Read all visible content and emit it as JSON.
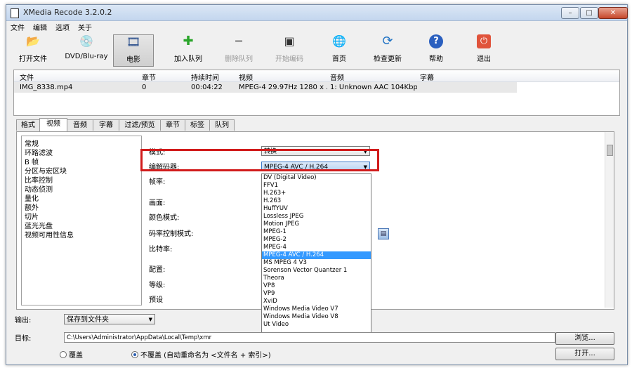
{
  "window": {
    "title": "XMedia Recode 3.2.0.2",
    "min_glyph": "–",
    "max_glyph": "□",
    "close_glyph": "✕"
  },
  "menu": [
    "文件",
    "编辑",
    "选项",
    "关于"
  ],
  "toolbar": [
    {
      "label": "打开文件",
      "icon": "open-folder-icon",
      "glyph": "📂"
    },
    {
      "label": "DVD/Blu-ray",
      "icon": "disc-icon",
      "glyph": "💿"
    },
    {
      "label": "电影",
      "icon": "film-icon",
      "glyph": "🎞",
      "active": true
    },
    {
      "label": "加入队列",
      "icon": "plus-icon",
      "glyph": "✚"
    },
    {
      "label": "删除队列",
      "icon": "minus-icon",
      "glyph": "━",
      "disabled": true
    },
    {
      "label": "开始编码",
      "icon": "encode-icon",
      "glyph": "▣",
      "disabled": true
    },
    {
      "label": "首页",
      "icon": "globe-icon",
      "glyph": "🌐"
    },
    {
      "label": "检查更新",
      "icon": "refresh-icon",
      "glyph": "⟳"
    },
    {
      "label": "帮助",
      "icon": "help-icon",
      "glyph": "?"
    },
    {
      "label": "退出",
      "icon": "power-icon",
      "glyph": "⏻"
    }
  ],
  "filelist": {
    "headers": [
      "文件",
      "章节",
      "持续时间",
      "视频",
      "音频",
      "字幕"
    ],
    "row": [
      "IMG_8338.mp4",
      "0",
      "00:04:22",
      "MPEG-4 29.97Hz 1280 x ...",
      "1: Unknown AAC 104Kbp...",
      ""
    ]
  },
  "tabs": [
    "格式",
    "视频",
    "音频",
    "字幕",
    "过滤/预览",
    "章节",
    "标签",
    "队列"
  ],
  "sidebar": [
    "常规",
    "环路滤波",
    "B 帧",
    "分区与宏区块",
    "比率控制",
    "动态侦测",
    "量化",
    "额外",
    "切片",
    "蓝光光盘",
    "视频可用性信息"
  ],
  "settings": {
    "mode_label": "模式:",
    "mode_value": "转换",
    "codec_label": "编解码器:",
    "codec_value": "MPEG-4 AVC / H.264",
    "labels": [
      "帧率:",
      "画面:",
      "颜色模式:",
      "码率控制模式:",
      "比特率:",
      "配置:",
      "等级:",
      "预设"
    ]
  },
  "dropdown": {
    "items": [
      "DV (Digital Video)",
      "FFV1",
      "H.263+",
      "H.263",
      "HuffYUV",
      "Lossless JPEG",
      "Motion JPEG",
      "MPEG-1",
      "MPEG-2",
      "MPEG-4",
      "MPEG-4 AVC / H.264",
      "MS MPEG 4 V3",
      "Sorenson Vector Quantzer 1",
      "Theora",
      "VP8",
      "VP9",
      "XviD",
      "Windows Media Video V7",
      "Windows Media Video V8",
      "Ut Video"
    ],
    "selected_index": 10
  },
  "output": {
    "output_label": "输出:",
    "output_value": "保存到文件夹",
    "target_label": "目标:",
    "target_value": "C:\\Users\\Administrator\\AppData\\Local\\Temp\\xmr",
    "browse_label": "浏览...",
    "open_label": "打开...",
    "radio_overwrite": "覆盖",
    "radio_no_overwrite": "不覆盖 (自动重命名为 <文件名 + 索引>)"
  },
  "colors": {
    "highlight": "#d11b1b",
    "selection": "#3399ff"
  }
}
